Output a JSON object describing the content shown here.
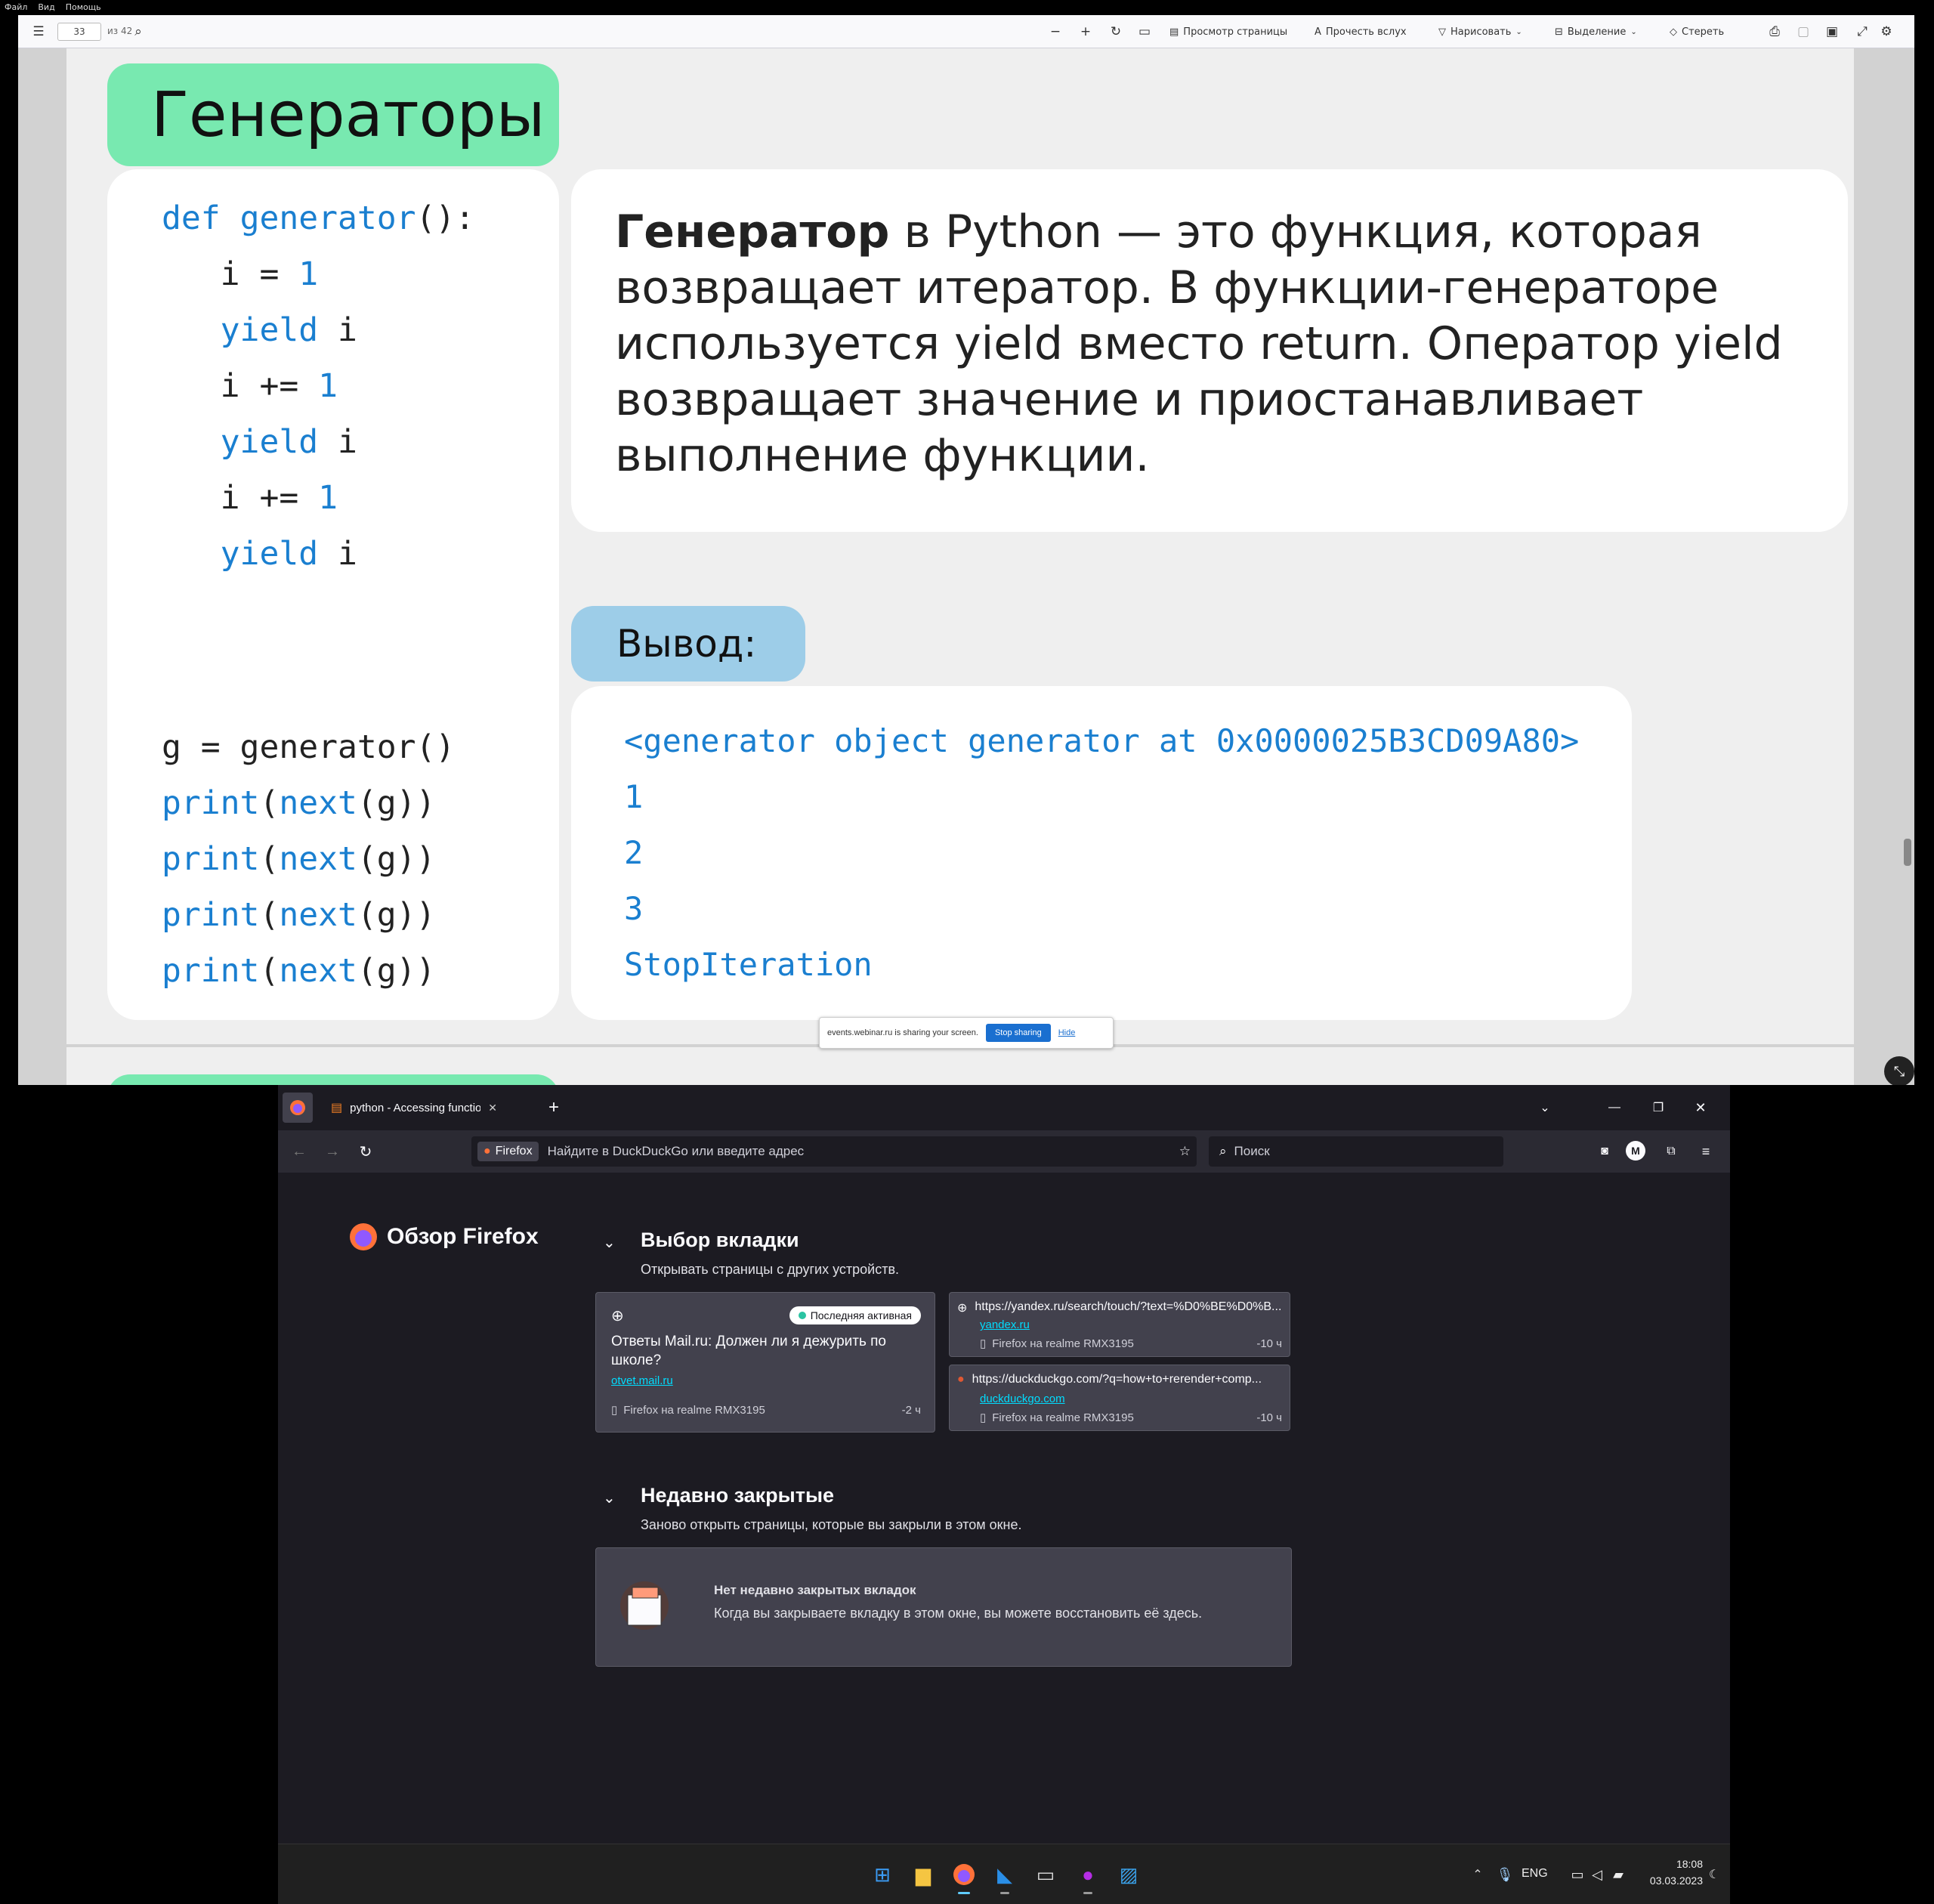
{
  "menubar": {
    "items": [
      "Файл",
      "Вид",
      "Помощь"
    ]
  },
  "pdf_toolbar": {
    "page_number": "33",
    "page_count": "из 42",
    "items": [
      "Просмотр страницы",
      "Прочесть вслух",
      "Нарисовать",
      "Выделение",
      "Стереть"
    ]
  },
  "slide": {
    "title": "Генераторы",
    "code_lines": [
      {
        "tokens": [
          {
            "t": "def ",
            "c": "kw"
          },
          {
            "t": "generator",
            "c": "kw"
          },
          {
            "t": "():",
            "c": ""
          }
        ]
      },
      {
        "tokens": [
          {
            "t": "   i = ",
            "c": ""
          },
          {
            "t": "1",
            "c": "num"
          }
        ]
      },
      {
        "tokens": [
          {
            "t": "   ",
            "c": ""
          },
          {
            "t": "yield",
            "c": "kw"
          },
          {
            "t": " i",
            "c": ""
          }
        ]
      },
      {
        "tokens": [
          {
            "t": "   i += ",
            "c": ""
          },
          {
            "t": "1",
            "c": "num"
          }
        ]
      },
      {
        "tokens": [
          {
            "t": "   ",
            "c": ""
          },
          {
            "t": "yield",
            "c": "kw"
          },
          {
            "t": " i",
            "c": ""
          }
        ]
      },
      {
        "tokens": [
          {
            "t": "   i += ",
            "c": ""
          },
          {
            "t": "1",
            "c": "num"
          }
        ]
      },
      {
        "tokens": [
          {
            "t": "   ",
            "c": ""
          },
          {
            "t": "yield",
            "c": "kw"
          },
          {
            "t": " i",
            "c": ""
          }
        ]
      }
    ],
    "code_lines2": [
      {
        "tokens": [
          {
            "t": "g = generator()",
            "c": ""
          }
        ]
      },
      {
        "tokens": [
          {
            "t": "print",
            "c": "kw"
          },
          {
            "t": "(",
            "c": ""
          },
          {
            "t": "next",
            "c": "kw"
          },
          {
            "t": "(g))",
            "c": ""
          }
        ]
      },
      {
        "tokens": [
          {
            "t": "print",
            "c": "kw"
          },
          {
            "t": "(",
            "c": ""
          },
          {
            "t": "next",
            "c": "kw"
          },
          {
            "t": "(g))",
            "c": ""
          }
        ]
      },
      {
        "tokens": [
          {
            "t": "print",
            "c": "kw"
          },
          {
            "t": "(",
            "c": ""
          },
          {
            "t": "next",
            "c": "kw"
          },
          {
            "t": "(g))",
            "c": ""
          }
        ]
      },
      {
        "tokens": [
          {
            "t": "print",
            "c": "kw"
          },
          {
            "t": "(",
            "c": ""
          },
          {
            "t": "next",
            "c": "kw"
          },
          {
            "t": "(g))",
            "c": ""
          }
        ]
      }
    ],
    "definition_bold": "Генератор",
    "definition_rest": " в Python — это функция, которая возвращает итератор. В функции-генераторе используется yield вместо return. Оператор yield возвращает значение и приостанавливает выполнение функции.",
    "output_title": "Вывод:",
    "output_lines": [
      "<generator object generator at 0x0000025B3CD09A80>",
      "1",
      "2",
      "3",
      "StopIteration"
    ]
  },
  "share_banner": {
    "text": "events.webinar.ru is sharing your screen.",
    "stop_label": "Stop sharing",
    "hide_label": "Hide"
  },
  "firefox": {
    "tab_title": "python - Accessing function arg",
    "url_badge": "Firefox",
    "url_placeholder": "Найдите в DuckDuckGo или введите адрес",
    "search_placeholder": "Поиск",
    "page_title": "Обзор Firefox",
    "synced": {
      "heading": "Выбор вкладки",
      "subheading": "Открывать страницы с других устройств.",
      "main_card": {
        "badge": "Последняя активная",
        "title": "Ответы Mail.ru: Должен ли я дежурить по школе?",
        "domain": "otvet.mail.ru",
        "device": "Firefox на realme RMX3195",
        "time": "-2 ч"
      },
      "cards": [
        {
          "url": "https://yandex.ru/search/touch/?text=%D0%BE%D0%B...",
          "domain": "yandex.ru",
          "device": "Firefox на realme RMX3195",
          "time": "-10 ч"
        },
        {
          "url": "https://duckduckgo.com/?q=how+to+rerender+comp...",
          "domain": "duckduckgo.com",
          "device": "Firefox на realme RMX3195",
          "time": "-10 ч"
        }
      ]
    },
    "closed": {
      "heading": "Недавно закрытые",
      "subheading": "Заново открыть страницы, которые вы закрыли в этом окне.",
      "empty_title": "Нет недавно закрытых вкладок",
      "empty_text": "Когда вы закрываете вкладку в этом окне, вы можете восстановить её здесь."
    }
  },
  "taskbar": {
    "lang": "ENG",
    "time": "18:08",
    "date": "03.03.2023"
  }
}
